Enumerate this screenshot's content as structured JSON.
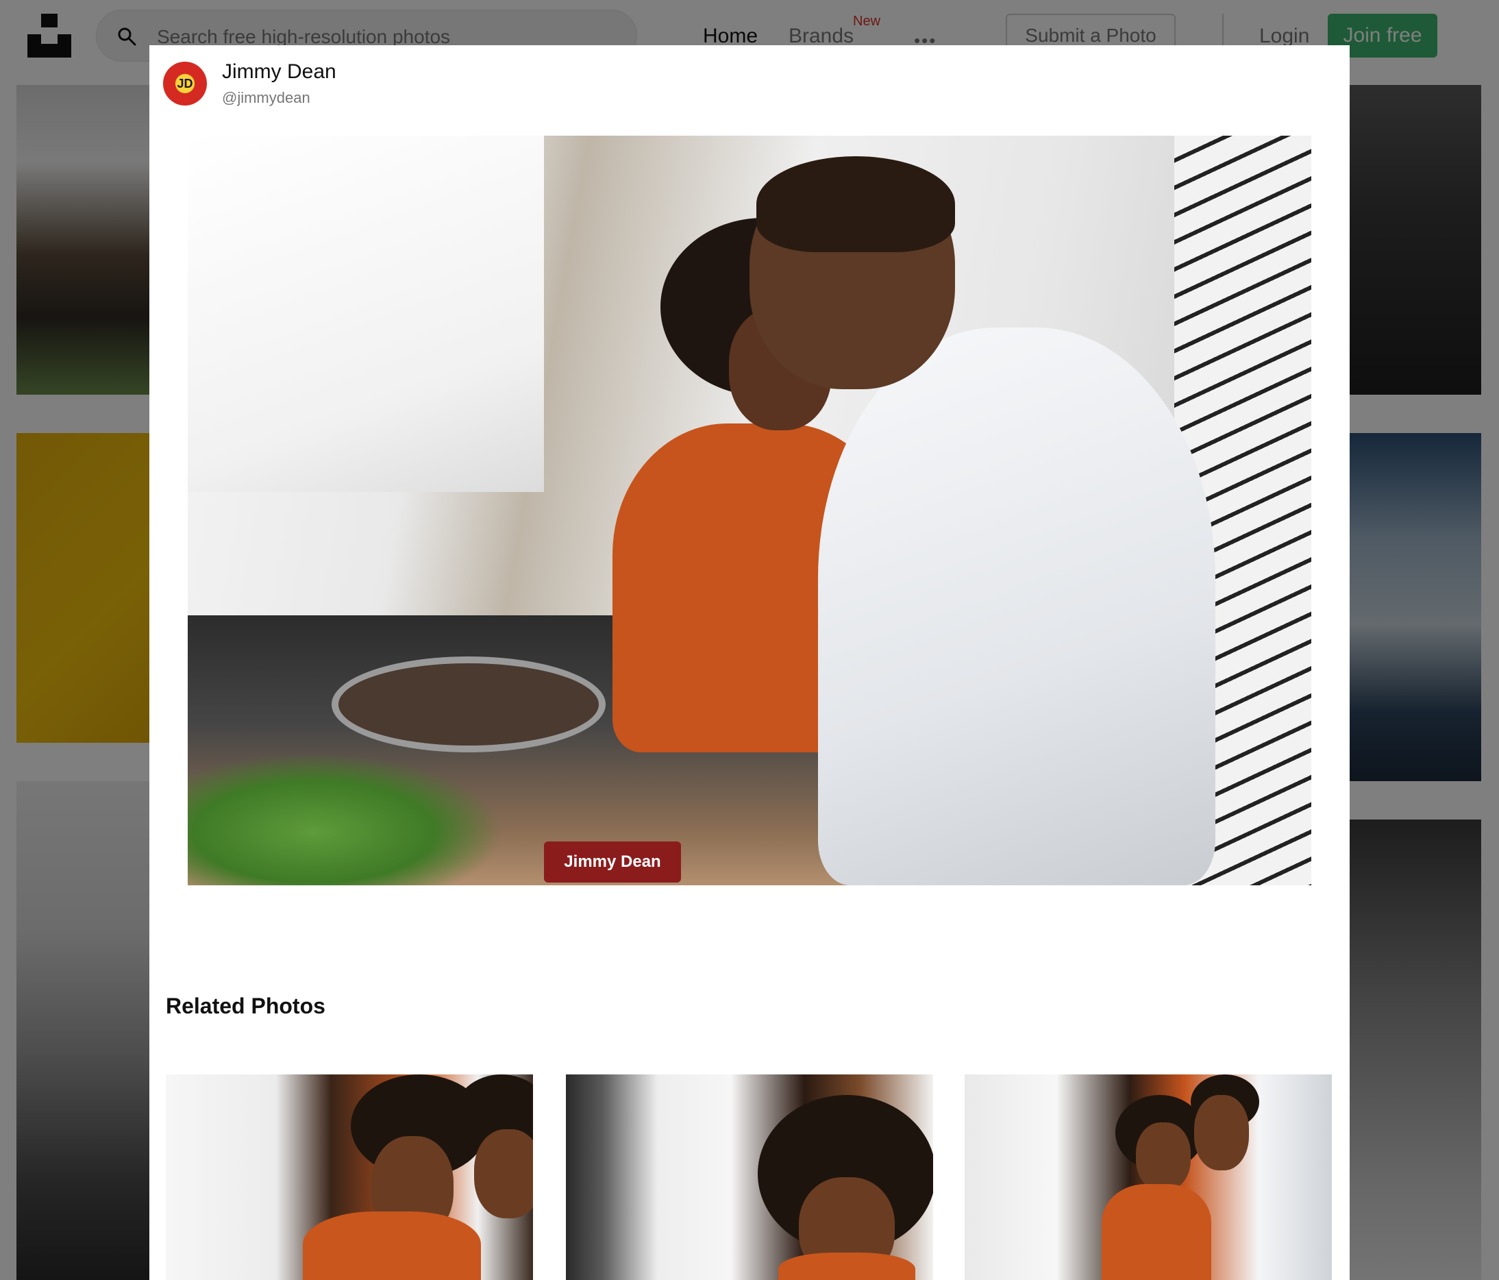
{
  "header": {
    "search_placeholder": "Search free high-resolution photos",
    "nav": {
      "home": "Home",
      "brands": "Brands",
      "brands_badge": "New",
      "more": "•••"
    },
    "submit_label": "Submit a Photo",
    "login_label": "Login",
    "join_label": "Join free"
  },
  "modal": {
    "author": {
      "name": "Jimmy Dean",
      "handle": "@jimmydean",
      "avatar_text": "JD"
    },
    "main_photo_packaging_text": "Jimmy Dean",
    "related_title": "Related Photos"
  },
  "colors": {
    "join_green": "#3cb46e",
    "badge_red": "#d93025",
    "overlay": "rgba(0,0,0,0.5)"
  },
  "icons": {
    "logo": "unsplash-logo-icon",
    "search": "search-icon",
    "more": "more-dots-icon"
  }
}
